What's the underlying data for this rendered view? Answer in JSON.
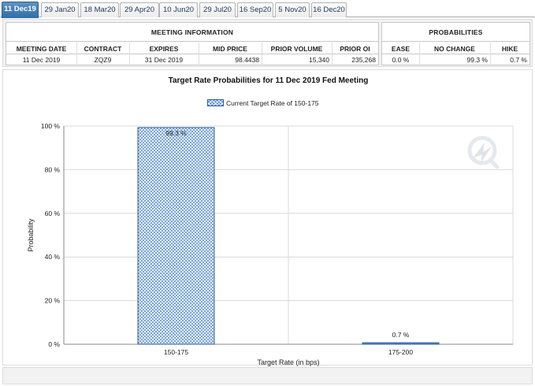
{
  "tabs": [
    {
      "label": "11 Dec19",
      "active": true
    },
    {
      "label": "29 Jan20",
      "active": false
    },
    {
      "label": "18 Mar20",
      "active": false
    },
    {
      "label": "29 Apr20",
      "active": false
    },
    {
      "label": "10 Jun20",
      "active": false
    },
    {
      "label": "29 Jul20",
      "active": false
    },
    {
      "label": "16 Sep20",
      "active": false
    },
    {
      "label": "5 Nov20",
      "active": false
    },
    {
      "label": "16 Dec20",
      "active": false
    }
  ],
  "meeting_info": {
    "title": "MEETING INFORMATION",
    "headers": [
      "MEETING DATE",
      "CONTRACT",
      "EXPIRES",
      "MID PRICE",
      "PRIOR VOLUME",
      "PRIOR OI"
    ],
    "values": [
      "11 Dec 2019",
      "ZQZ9",
      "31 Dec 2019",
      "98.4438",
      "15,340",
      "235,268"
    ]
  },
  "probabilities": {
    "title": "PROBABILITIES",
    "headers": [
      "EASE",
      "NO CHANGE",
      "HIKE"
    ],
    "values": [
      "0.0 %",
      "99.3 %",
      "0.7 %"
    ]
  },
  "colors": {
    "accent": "#2e6da7",
    "bar_fill": "#5a8fcf",
    "bar_outline": "#2f5e97",
    "grid": "#cccccc"
  },
  "chart_data": {
    "type": "bar",
    "title": "Target Rate Probabilities for 11 Dec 2019 Fed Meeting",
    "legend": "Current Target Rate of 150-175",
    "xlabel": "Target Rate (in bps)",
    "ylabel": "Probability",
    "categories": [
      "150-175",
      "175-200"
    ],
    "values": [
      99.3,
      0.7
    ],
    "value_labels": [
      "99.3 %",
      "0.7 %"
    ],
    "highlight": [
      true,
      false
    ],
    "ylim": [
      0,
      100
    ],
    "yticks": [
      0,
      20,
      40,
      60,
      80,
      100
    ],
    "ytick_labels": [
      "0 %",
      "20 %",
      "40 %",
      "60 %",
      "80 %",
      "100 %"
    ],
    "grid": true,
    "legend_position": "top-center",
    "watermark_icon": "cme-logo-icon"
  }
}
